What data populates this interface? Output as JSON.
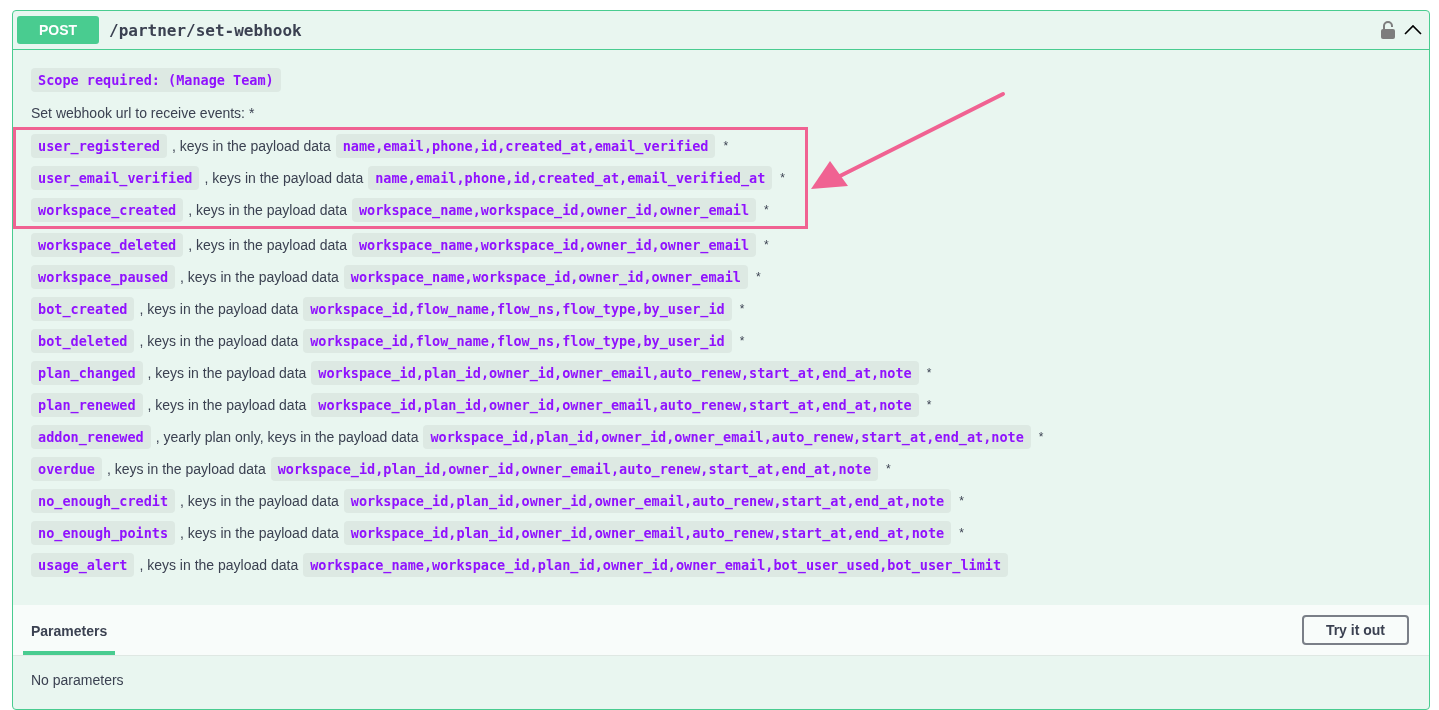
{
  "operation": {
    "method": "POST",
    "path": "/partner/set-webhook",
    "expanded": true
  },
  "scope": "Scope required: (Manage Team)",
  "description": "Set webhook url to receive events: *",
  "events": [
    {
      "name": "user_registered",
      "text": ", keys in the payload data",
      "keys": "name,email,phone,id,created_at,email_verified",
      "mark": "*",
      "highlighted": true
    },
    {
      "name": "user_email_verified",
      "text": ", keys in the payload data",
      "keys": "name,email,phone,id,created_at,email_verified_at",
      "mark": "*",
      "highlighted": true
    },
    {
      "name": "workspace_created",
      "text": ", keys in the payload data",
      "keys": "workspace_name,workspace_id,owner_id,owner_email",
      "mark": "*",
      "highlighted": true
    },
    {
      "name": "workspace_deleted",
      "text": ", keys in the payload data",
      "keys": "workspace_name,workspace_id,owner_id,owner_email",
      "mark": "*",
      "highlighted": false
    },
    {
      "name": "workspace_paused",
      "text": ", keys in the payload data",
      "keys": "workspace_name,workspace_id,owner_id,owner_email",
      "mark": "*",
      "highlighted": false
    },
    {
      "name": "bot_created",
      "text": ", keys in the payload data",
      "keys": "workspace_id,flow_name,flow_ns,flow_type,by_user_id",
      "mark": "*",
      "highlighted": false
    },
    {
      "name": "bot_deleted",
      "text": ", keys in the payload data",
      "keys": "workspace_id,flow_name,flow_ns,flow_type,by_user_id",
      "mark": "*",
      "highlighted": false
    },
    {
      "name": "plan_changed",
      "text": ", keys in the payload data",
      "keys": "workspace_id,plan_id,owner_id,owner_email,auto_renew,start_at,end_at,note",
      "mark": "*",
      "highlighted": false
    },
    {
      "name": "plan_renewed",
      "text": ", keys in the payload data",
      "keys": "workspace_id,plan_id,owner_id,owner_email,auto_renew,start_at,end_at,note",
      "mark": "*",
      "highlighted": false
    },
    {
      "name": "addon_renewed",
      "text": ", yearly plan only, keys in the payload data",
      "keys": "workspace_id,plan_id,owner_id,owner_email,auto_renew,start_at,end_at,note",
      "mark": "*",
      "highlighted": false
    },
    {
      "name": "overdue",
      "text": ", keys in the payload data",
      "keys": "workspace_id,plan_id,owner_id,owner_email,auto_renew,start_at,end_at,note",
      "mark": "*",
      "highlighted": false
    },
    {
      "name": "no_enough_credit",
      "text": ", keys in the payload data",
      "keys": "workspace_id,plan_id,owner_id,owner_email,auto_renew,start_at,end_at,note",
      "mark": "*",
      "highlighted": false
    },
    {
      "name": "no_enough_points",
      "text": ", keys in the payload data",
      "keys": "workspace_id,plan_id,owner_id,owner_email,auto_renew,start_at,end_at,note",
      "mark": "*",
      "highlighted": false
    },
    {
      "name": "usage_alert",
      "text": ", keys in the payload data",
      "keys": "workspace_name,workspace_id,plan_id,owner_id,owner_email,bot_user_used,bot_user_limit",
      "highlighted": false
    }
  ],
  "parameters": {
    "tab": "Parameters",
    "button": "Try it out",
    "empty": "No parameters"
  }
}
